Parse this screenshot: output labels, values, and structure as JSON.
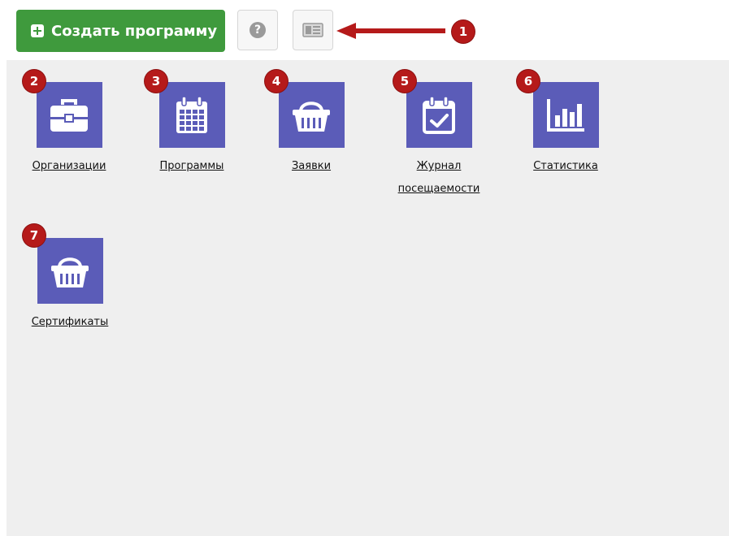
{
  "toolbar": {
    "create_label": "Создать программу",
    "help_symbol": "?",
    "annotation_number": "1"
  },
  "tiles": [
    {
      "badge": "2",
      "label": "Организации",
      "icon": "briefcase-icon"
    },
    {
      "badge": "3",
      "label": "Программы",
      "icon": "calendar-icon"
    },
    {
      "badge": "4",
      "label": "Заявки",
      "icon": "basket-icon"
    },
    {
      "badge": "5",
      "label_line1": "Журнал",
      "label_line2": "посещаемости",
      "icon": "calendar-check-icon"
    },
    {
      "badge": "6",
      "label": "Статистика",
      "icon": "bar-chart-icon"
    },
    {
      "badge": "7",
      "label": "Сертификаты",
      "icon": "basket-icon"
    }
  ],
  "colors": {
    "accent_green": "#3f9a3d",
    "tile_purple": "#5b5cb8",
    "badge_red": "#b51a1a",
    "workspace_bg": "#efefef"
  }
}
